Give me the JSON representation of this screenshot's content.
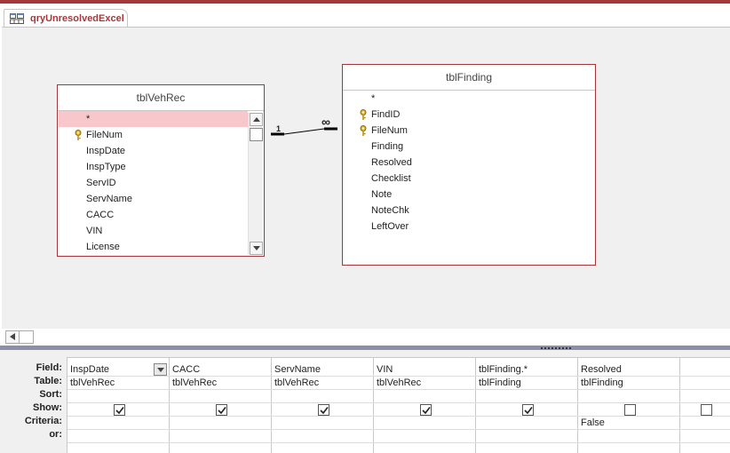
{
  "tab": {
    "label": "qryUnresolvedExcel",
    "icon": "query-icon"
  },
  "tables": {
    "left": {
      "name": "tblVehRec",
      "fields": [
        "*",
        "FileNum",
        "InspDate",
        "InspType",
        "ServID",
        "ServName",
        "CACC",
        "VIN",
        "License"
      ],
      "key_fields": [
        "FileNum"
      ]
    },
    "right": {
      "name": "tblFinding",
      "fields": [
        "*",
        "FindID",
        "FileNum",
        "Finding",
        "Resolved",
        "Checklist",
        "Note",
        "NoteChk",
        "LeftOver"
      ],
      "key_fields": [
        "FindID",
        "FileNum"
      ]
    }
  },
  "relationship": {
    "one_label": "1",
    "many_label": "∞"
  },
  "grid": {
    "row_labels": {
      "field": "Field:",
      "table": "Table:",
      "sort": "Sort:",
      "show": "Show:",
      "criteria": "Criteria:",
      "or": "or:"
    },
    "columns": [
      {
        "field": "InspDate",
        "table": "tblVehRec",
        "sort": "",
        "show": true,
        "criteria": "",
        "or": ""
      },
      {
        "field": "CACC",
        "table": "tblVehRec",
        "sort": "",
        "show": true,
        "criteria": "",
        "or": ""
      },
      {
        "field": "ServName",
        "table": "tblVehRec",
        "sort": "",
        "show": true,
        "criteria": "",
        "or": ""
      },
      {
        "field": "VIN",
        "table": "tblVehRec",
        "sort": "",
        "show": true,
        "criteria": "",
        "or": ""
      },
      {
        "field": "tblFinding.*",
        "table": "tblFinding",
        "sort": "",
        "show": true,
        "criteria": "",
        "or": ""
      },
      {
        "field": "Resolved",
        "table": "tblFinding",
        "sort": "",
        "show": false,
        "criteria": "False",
        "or": ""
      },
      {
        "field": "",
        "table": "",
        "sort": "",
        "show": false,
        "criteria": "",
        "or": ""
      }
    ]
  },
  "colors": {
    "accent": "#a4373a",
    "selected_row": "#f8c7cb",
    "splitter": "#8b8fa8"
  }
}
